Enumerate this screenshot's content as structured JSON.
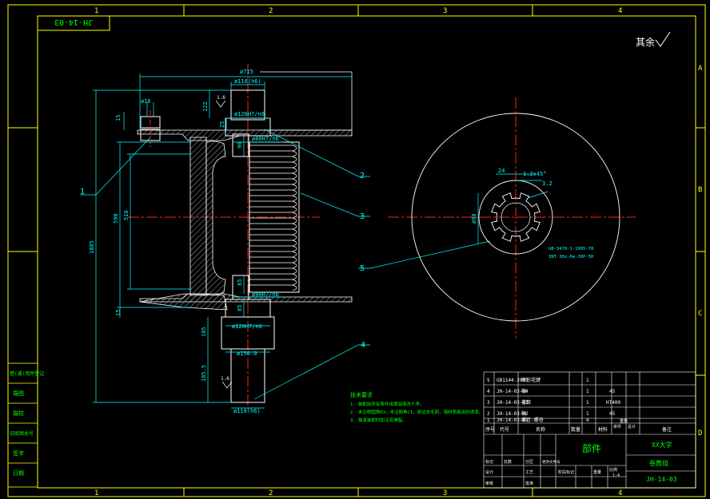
{
  "colors": {
    "background": "#000000",
    "frame": "#ffff00",
    "dimension": "#00ffff",
    "outline": "#ffffff",
    "centerline": "#ff2020",
    "notes": "#00ff00",
    "title_text": "#00ff00",
    "hatch": "#c8c8c8"
  },
  "frame": {
    "zones_top": [
      "1",
      "2",
      "3",
      "4"
    ],
    "zones_side": [
      "A",
      "B",
      "C",
      "D"
    ],
    "drawing_code": "JH-14-03"
  },
  "roughness_note": "其余",
  "dimensions": {
    "overall_width": "ø715",
    "upper_shaft_dia": "ø110",
    "upper_shaft_fit": "ø110(h6)",
    "bearing_fit_top": "ø120H7/n6",
    "hub_fit_top": "ø80H7/n6",
    "hub_fit_bottom": "ø80H7/n6",
    "bearing_fit_bottom": "ø120H7/n6",
    "lower_collar_dia": "ø150.0",
    "lower_shaft_fit": "ø110(h6)",
    "bolt_dia": "ø16",
    "flange_thk_top": "15",
    "flange_thk_bottom": "15",
    "len_122": "122",
    "len_25": "25",
    "len_90_top": "90",
    "len_85": "85",
    "len_85b": "85",
    "len_105": "105",
    "len_185_5": "185.5",
    "drum_height": "590",
    "inner_height": "510",
    "overall_height": "1885",
    "rough_top": "1.6",
    "rough_bottom": "1.6",
    "key_width": "24",
    "chamfer": "1.2x45°",
    "rough_side": "3.2",
    "bore_dia": "ø90",
    "spline_note_1": "GB-3478-1-1995-78",
    "spline_note_2": "INT-30z-6m-30P-5H"
  },
  "leaders": [
    "1",
    "2",
    "3",
    "4",
    "5"
  ],
  "tech_notes": {
    "title": "技术要求",
    "lines": [
      "1. 装配前所有零件用煤油清洗干净。",
      "2. 未注明圆角R3，未注倒角C1，锐边去毛刺，钢材表面涂防锈漆。",
      "3. 轴承装配时加注润滑脂。"
    ]
  },
  "parts_list": {
    "rows": [
      {
        "no": "5",
        "code": "GB1144-2001",
        "name": "矩形花键",
        "qty": "1",
        "material": "",
        "note": ""
      },
      {
        "no": "4",
        "code": "JH-14-03-04",
        "name": "轴",
        "qty": "1",
        "material": "45",
        "note": ""
      },
      {
        "no": "3",
        "code": "JH-14-03-03",
        "name": "卷筒",
        "qty": "1",
        "material": "HT400",
        "note": ""
      },
      {
        "no": "2",
        "code": "JH-14-03-02",
        "name": "轴",
        "qty": "1",
        "material": "45",
        "note": ""
      },
      {
        "no": "1",
        "code": "JH-14-03-01",
        "name": "螺栓-螺母",
        "qty": "4",
        "material": "",
        "note": ""
      }
    ],
    "header": [
      "序号",
      "代号",
      "名称",
      "数量",
      "材料",
      "单件",
      "总计",
      "备注"
    ],
    "mass_label": "重量"
  },
  "title_block": {
    "part_label": "部件",
    "university": "XX大学",
    "assembly_name": "卷筒组",
    "drawing_no": "JH-14-03",
    "scale": "1:4",
    "row_labels": [
      "标记",
      "处数",
      "分区",
      "更改文件号",
      "签名",
      "年月日"
    ],
    "bottom_labels": [
      "设计",
      "审核",
      "工艺",
      "批准"
    ],
    "stage_labels": [
      "阶段标记",
      "重量",
      "比例"
    ]
  },
  "side_table": [
    "借(通)用件登记",
    "描图",
    "描校",
    "旧底图总号",
    "签字",
    "日期"
  ]
}
